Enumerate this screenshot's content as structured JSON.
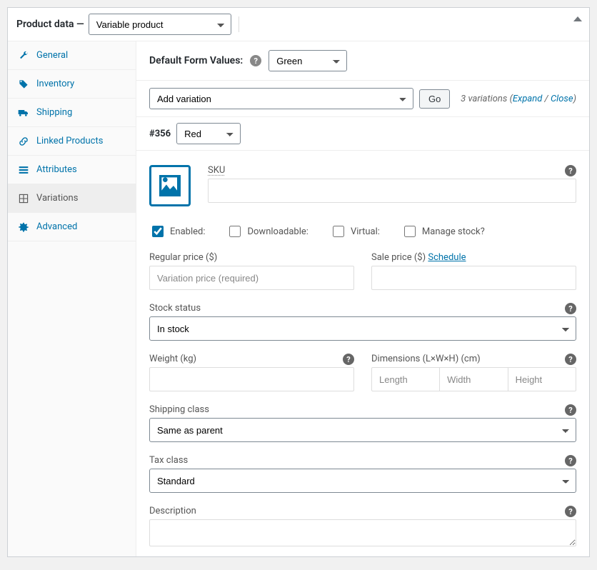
{
  "header": {
    "title": "Product data —",
    "type_selected": "Variable product"
  },
  "sidebar": {
    "items": [
      {
        "id": "general",
        "label": "General"
      },
      {
        "id": "inventory",
        "label": "Inventory"
      },
      {
        "id": "shipping",
        "label": "Shipping"
      },
      {
        "id": "linked",
        "label": "Linked Products"
      },
      {
        "id": "attributes",
        "label": "Attributes"
      },
      {
        "id": "variations",
        "label": "Variations"
      },
      {
        "id": "advanced",
        "label": "Advanced"
      }
    ],
    "active": "variations"
  },
  "defaultForm": {
    "label": "Default Form Values:",
    "selected": "Green"
  },
  "addVariation": {
    "selected": "Add variation",
    "go": "Go",
    "summary_count": "3 variations",
    "expand": "Expand",
    "close": "Close"
  },
  "variation": {
    "id": "#356",
    "attr_selected": "Red",
    "sku_label": "SKU",
    "checks": {
      "enabled": "Enabled:",
      "downloadable": "Downloadable:",
      "virtual": "Virtual:",
      "manage_stock": "Manage stock?"
    },
    "regular_price_label": "Regular price ($)",
    "regular_price_placeholder": "Variation price (required)",
    "sale_price_label": "Sale price ($)",
    "sale_schedule": "Schedule",
    "stock_status_label": "Stock status",
    "stock_status_value": "In stock",
    "weight_label": "Weight (kg)",
    "dimensions_label": "Dimensions (L×W×H) (cm)",
    "dim_l": "Length",
    "dim_w": "Width",
    "dim_h": "Height",
    "shipping_class_label": "Shipping class",
    "shipping_class_value": "Same as parent",
    "tax_class_label": "Tax class",
    "tax_class_value": "Standard",
    "description_label": "Description"
  }
}
